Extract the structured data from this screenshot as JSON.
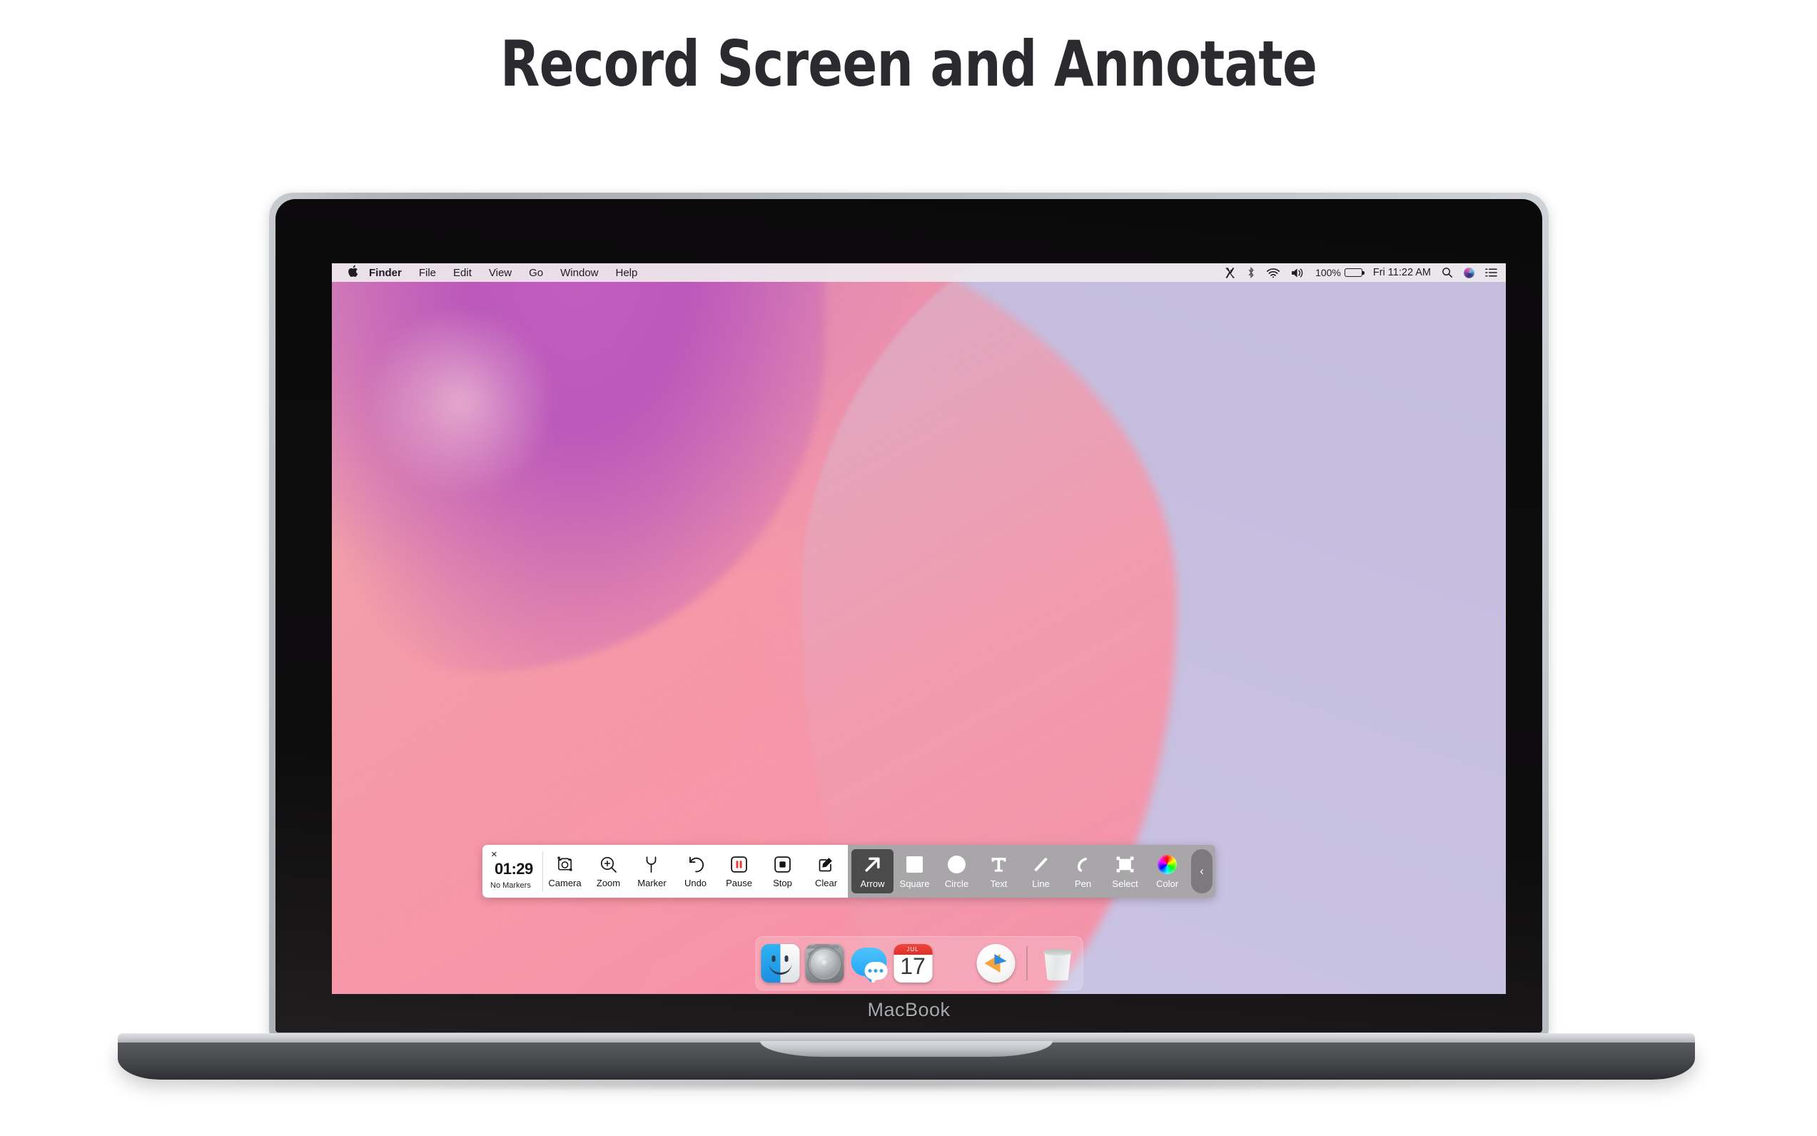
{
  "page": {
    "headline": "Record Screen and Annotate",
    "device_label": "MacBook"
  },
  "menubar": {
    "apple_glyph": "",
    "items": [
      {
        "label": "Finder",
        "bold": true
      },
      {
        "label": "File",
        "bold": false
      },
      {
        "label": "Edit",
        "bold": false
      },
      {
        "label": "View",
        "bold": false
      },
      {
        "label": "Go",
        "bold": false
      },
      {
        "label": "Window",
        "bold": false
      },
      {
        "label": "Help",
        "bold": false
      }
    ],
    "status": {
      "app_icon": "x-app-icon",
      "bluetooth_icon": "bluetooth-icon",
      "wifi_icon": "wifi-icon",
      "volume_icon": "volume-icon",
      "battery_percent": "100%",
      "battery_icon": "battery-full-icon",
      "clock": "Fri 11:22 AM",
      "spotlight_icon": "search-icon",
      "siri_icon": "siri-icon",
      "control_center_icon": "list-icon"
    }
  },
  "recorder": {
    "close_glyph": "×",
    "time": "01:29",
    "markers": "No Markers",
    "buttons": [
      {
        "label": "Camera",
        "icon": "camera-icon"
      },
      {
        "label": "Zoom",
        "icon": "zoom-in-icon"
      },
      {
        "label": "Marker",
        "icon": "marker-pin-icon"
      },
      {
        "label": "Undo",
        "icon": "undo-icon"
      },
      {
        "label": "Pause",
        "icon": "pause-icon"
      },
      {
        "label": "Stop",
        "icon": "stop-icon"
      },
      {
        "label": "Clear",
        "icon": "clear-pencil-icon"
      }
    ],
    "tools": [
      {
        "label": "Arrow",
        "icon": "arrow-up-right-icon",
        "active": true
      },
      {
        "label": "Square",
        "icon": "square-icon",
        "active": false
      },
      {
        "label": "Circle",
        "icon": "circle-icon",
        "active": false
      },
      {
        "label": "Text",
        "icon": "text-icon",
        "active": false
      },
      {
        "label": "Line",
        "icon": "line-icon",
        "active": false
      },
      {
        "label": "Pen",
        "icon": "pen-stroke-icon",
        "active": false
      },
      {
        "label": "Select",
        "icon": "select-frame-icon",
        "active": false
      },
      {
        "label": "Color",
        "icon": "color-wheel-icon",
        "active": false
      }
    ],
    "collapse_glyph": "‹",
    "active_tool_bg": "#4b4b4b",
    "panel_bg": "#a8a6a9"
  },
  "dock": {
    "items": [
      {
        "name": "Finder",
        "icon": "finder-icon"
      },
      {
        "name": "System Preferences",
        "icon": "gear-icon"
      },
      {
        "name": "Messages",
        "icon": "messages-icon"
      },
      {
        "name": "Calendar",
        "icon": "calendar-icon",
        "day": "17",
        "month": "JUL"
      },
      {
        "name": "App",
        "icon": "app-arrow-icon"
      },
      {
        "name": "Trash",
        "icon": "trash-icon"
      }
    ]
  },
  "theme": {
    "headline_color": "#2b2b2f",
    "wallpaper_pink": "#f2a6ad",
    "wallpaper_purple": "#c45fc0",
    "wallpaper_lilac": "#c4bedf",
    "pause_red": "#e8352a"
  }
}
